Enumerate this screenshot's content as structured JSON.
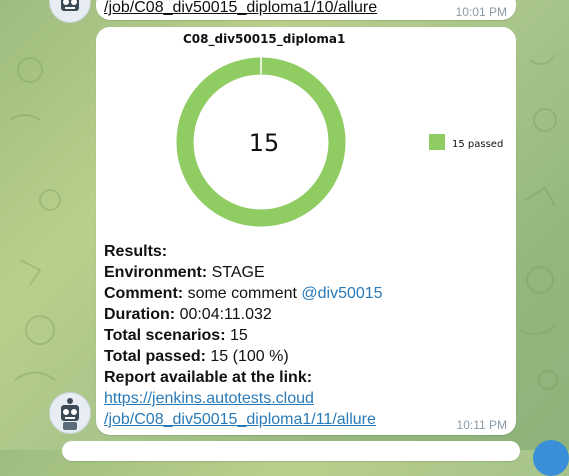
{
  "prev_message": {
    "link_tail": "/job/C08_div50015_diploma1/10/allure",
    "time": "10:01 PM"
  },
  "message": {
    "chart_title": "C08_div50015_diploma1",
    "chart_center": "15",
    "legend_label": "15 passed",
    "results_label": "Results:",
    "environment_label": "Environment:",
    "environment_value": "STAGE",
    "comment_label": "Comment:",
    "comment_value": "some comment",
    "comment_mention": "@div50015",
    "duration_label": "Duration:",
    "duration_value": "00:04:11.032",
    "scenarios_label": "Total scenarios:",
    "scenarios_value": "15",
    "passed_label": "Total passed:",
    "passed_value": "15 (100 %)",
    "report_label": "Report available at the link:",
    "link_line1": "https://jenkins.autotests.cloud",
    "link_line2": "/job/C08_div50015_diploma1/11/allure",
    "time": "10:11 PM"
  },
  "chart_data": {
    "type": "pie",
    "title": "C08_div50015_diploma1",
    "categories": [
      "passed"
    ],
    "series": [
      {
        "name": "15 passed",
        "values": [
          15
        ]
      }
    ],
    "total": 15,
    "colors": {
      "passed": "#8fcc62"
    },
    "legend": "right"
  },
  "colors": {
    "accent": "#2a7ab7",
    "passed": "#8fcc62",
    "bubble": "#ffffff"
  }
}
